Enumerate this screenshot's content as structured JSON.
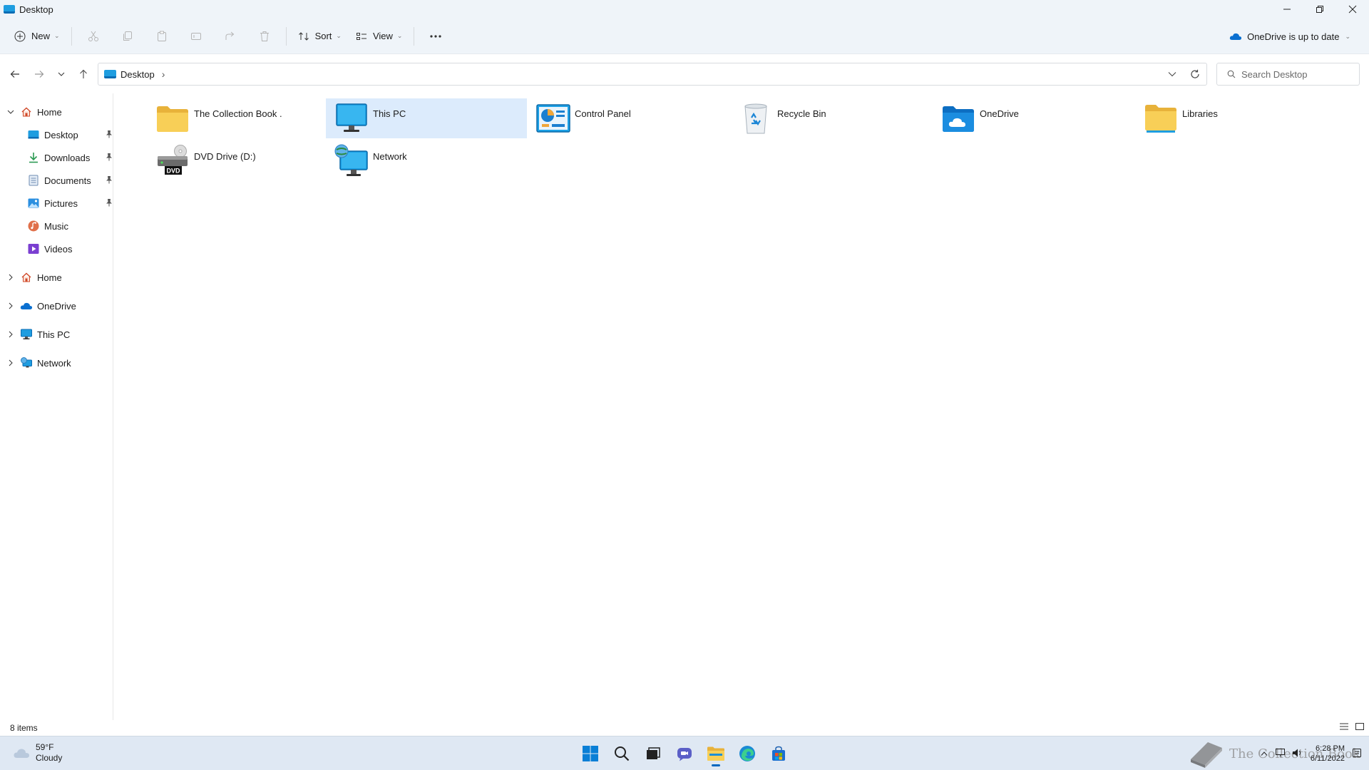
{
  "window": {
    "title": "Desktop"
  },
  "commandbar": {
    "new_label": "New",
    "sort_label": "Sort",
    "view_label": "View",
    "onedrive_status": "OneDrive is up to date"
  },
  "address": {
    "breadcrumb": "Desktop",
    "search_placeholder": "Search Desktop"
  },
  "sidebar": {
    "quick_access": [
      {
        "label": "Home"
      },
      {
        "label": "Desktop"
      },
      {
        "label": "Downloads"
      },
      {
        "label": "Documents"
      },
      {
        "label": "Pictures"
      },
      {
        "label": "Music"
      },
      {
        "label": "Videos"
      }
    ],
    "roots": [
      {
        "label": "Home"
      },
      {
        "label": "OneDrive"
      },
      {
        "label": "This PC"
      },
      {
        "label": "Network"
      }
    ]
  },
  "items": [
    {
      "name": "The Collection Book .",
      "icon": "folder-icon"
    },
    {
      "name": "This PC",
      "icon": "computer-icon",
      "selected": true
    },
    {
      "name": "Control Panel",
      "icon": "control-panel-icon"
    },
    {
      "name": "Recycle Bin",
      "icon": "recycle-bin-icon"
    },
    {
      "name": "OneDrive",
      "icon": "onedrive-folder-icon"
    },
    {
      "name": "Libraries",
      "icon": "libraries-icon"
    },
    {
      "name": "DVD Drive (D:)",
      "icon": "dvd-drive-icon",
      "badge": "DVD"
    },
    {
      "name": "Network",
      "icon": "network-icon"
    }
  ],
  "status": {
    "item_count": "8 items"
  },
  "taskbar": {
    "weather_temp": "59°F",
    "weather_desc": "Cloudy",
    "time": "6:28 PM",
    "date": "6/11/2022",
    "watermark": "The Collection Book"
  },
  "colors": {
    "accent": "#0067c0",
    "selection": "#dcebfc",
    "folder": "#f8c94b"
  }
}
